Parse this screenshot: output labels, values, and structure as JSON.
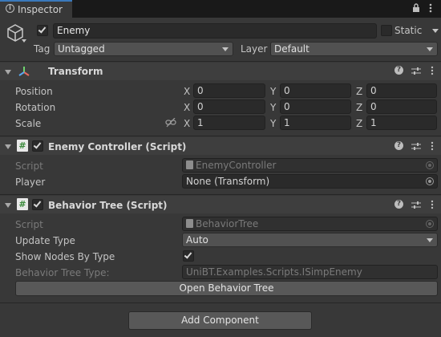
{
  "tab": {
    "title": "Inspector"
  },
  "object": {
    "name": "Enemy",
    "static_label": "Static",
    "tag_label": "Tag",
    "tag_value": "Untagged",
    "layer_label": "Layer",
    "layer_value": "Default"
  },
  "transform": {
    "title": "Transform",
    "rows": [
      {
        "label": "Position",
        "x": "0",
        "y": "0",
        "z": "0"
      },
      {
        "label": "Rotation",
        "x": "0",
        "y": "0",
        "z": "0"
      },
      {
        "label": "Scale",
        "x": "1",
        "y": "1",
        "z": "1"
      }
    ],
    "axes": {
      "x": "X",
      "y": "Y",
      "z": "Z"
    }
  },
  "enemy_controller": {
    "title": "Enemy Controller (Script)",
    "script_label": "Script",
    "script_value": "EnemyController",
    "player_label": "Player",
    "player_value": "None (Transform)"
  },
  "behavior_tree": {
    "title": "Behavior Tree (Script)",
    "script_label": "Script",
    "script_value": "BehaviorTree",
    "update_type_label": "Update Type",
    "update_type_value": "Auto",
    "show_nodes_label": "Show Nodes By Type",
    "tree_type_label": "Behavior Tree Type:",
    "tree_type_value": "UniBT.Examples.Scripts.ISimpEnemy",
    "open_button": "Open Behavior Tree"
  },
  "add_component": "Add Component",
  "colors": {
    "background": "#383838",
    "header": "#3e3e3e",
    "field": "#2a2a2a",
    "accent": "#3a79bb"
  }
}
